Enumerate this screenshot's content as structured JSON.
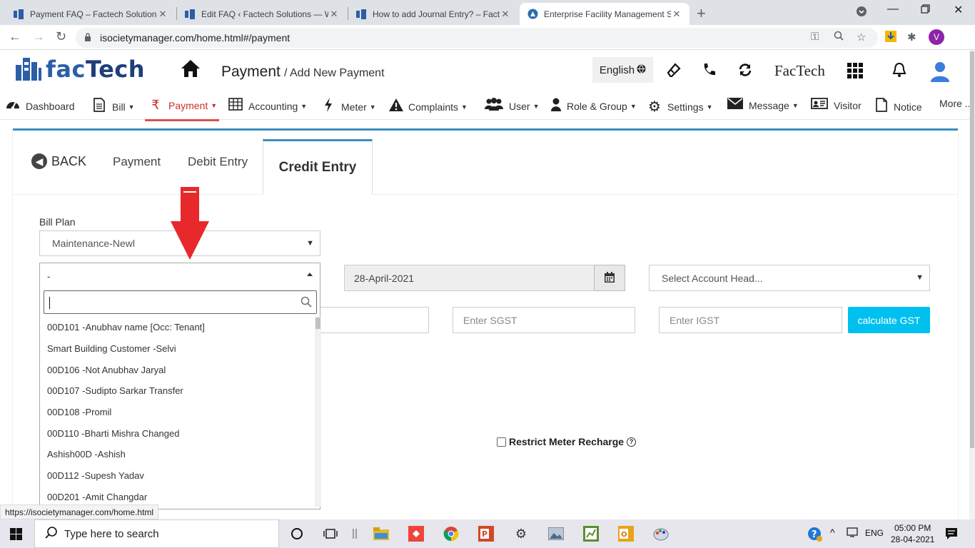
{
  "browser": {
    "tabs": [
      {
        "title": "Payment FAQ – Factech Solutions",
        "active": false
      },
      {
        "title": "Edit FAQ ‹ Factech Solutions — W",
        "active": false
      },
      {
        "title": "How to add Journal Entry? – Fact",
        "active": false
      },
      {
        "title": "Enterprise Facility Management S",
        "active": true
      }
    ],
    "url": "isocietymanager.com/home.html#/payment",
    "profile_initial": "V",
    "status_url": "https://isocietymanager.com/home.html"
  },
  "header": {
    "logo_text_a": "fac",
    "logo_text_b": "Tech",
    "page_title": "Payment",
    "page_subtitle": "/ Add New Payment",
    "language": "English",
    "brand": "FacTech"
  },
  "nav": [
    {
      "label": "Dashboard",
      "icon": "dashboard-icon",
      "caret": false
    },
    {
      "label": "Bill",
      "icon": "document-icon",
      "caret": true
    },
    {
      "label": "Payment",
      "icon": "rupee-icon",
      "caret": true,
      "active": true
    },
    {
      "label": "Accounting",
      "icon": "table-icon",
      "caret": true
    },
    {
      "label": "Meter",
      "icon": "bolt-icon",
      "caret": true
    },
    {
      "label": "Complaints",
      "icon": "warning-icon",
      "caret": true
    },
    {
      "label": "User",
      "icon": "users-icon",
      "caret": true
    },
    {
      "label": "Role & Group",
      "icon": "person-icon",
      "caret": true
    },
    {
      "label": "Settings",
      "icon": "gear-icon",
      "caret": true
    },
    {
      "label": "Message",
      "icon": "envelope-icon",
      "caret": true
    },
    {
      "label": "Visitor",
      "icon": "id-card-icon",
      "caret": false
    },
    {
      "label": "Notice",
      "icon": "notice-icon",
      "caret": false
    },
    {
      "label": "More ..",
      "icon": "",
      "caret": false
    }
  ],
  "subtabs": {
    "back": "BACK",
    "payment": "Payment",
    "debit": "Debit Entry",
    "credit": "Credit Entry"
  },
  "form": {
    "bill_plan_label": "Bill Plan",
    "bill_plan_value": "Maintenance-Newl",
    "member_select_value": "-",
    "date_value": "28-April-2021",
    "account_head_placeholder": "Select Account Head...",
    "sgst_placeholder": "Enter SGST",
    "igst_placeholder": "Enter IGST",
    "calc_gst_label": "calculate GST",
    "restrict_label": "Restrict Meter Recharge"
  },
  "dropdown": {
    "search_value": "",
    "options": [
      "00D101 -Anubhav name [Occ: Tenant]",
      "Smart Building Customer -Selvi",
      "00D106 -Not Anubhav Jaryal",
      "00D107 -Sudipto Sarkar Transfer",
      "00D108 -Promil",
      "00D110 -Bharti Mishra Changed",
      "Ashish00D -Ashish",
      "00D112 -Supesh Yadav",
      "00D201 -Amit Changdar"
    ]
  },
  "taskbar": {
    "search_placeholder": "Type here to search",
    "lang": "ENG",
    "time": "05:00 PM",
    "date": "28-04-2021"
  },
  "colors": {
    "accent": "#3c8dbc",
    "nav_active": "#c9302c",
    "gst_button": "#00c0ef",
    "arrow": "#e8282b"
  }
}
